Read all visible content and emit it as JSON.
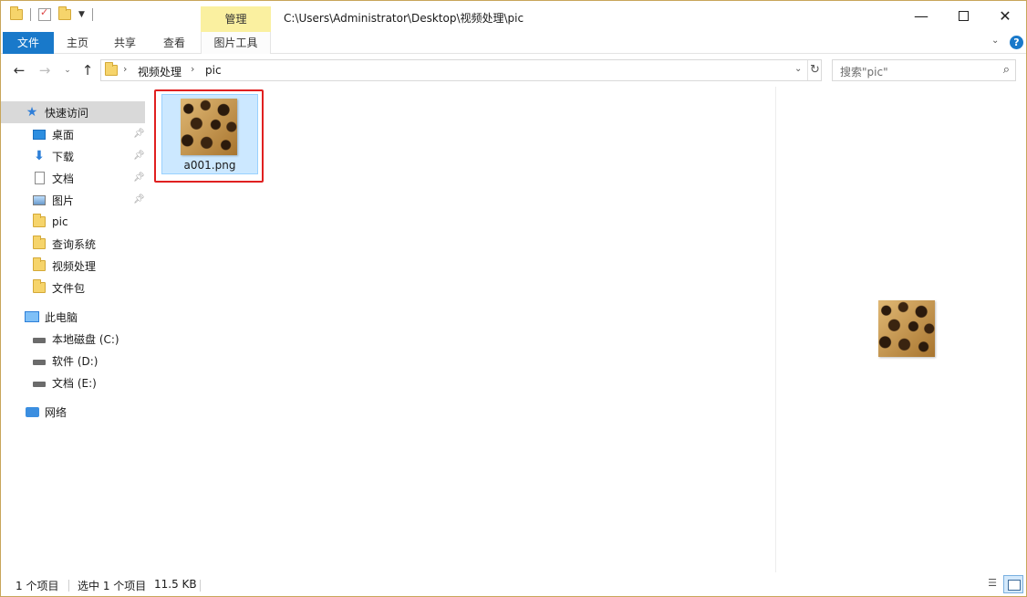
{
  "titlebar": {
    "path": "C:\\Users\\Administrator\\Desktop\\视频处理\\pic",
    "context_tab": "管理",
    "minimize": "—",
    "close": "✕"
  },
  "ribbon": {
    "tabs": [
      "文件",
      "主页",
      "共享",
      "查看",
      "图片工具"
    ],
    "help": "?",
    "collapse": "⌄"
  },
  "address": {
    "crumbs": [
      "视频处理",
      "pic"
    ],
    "separator": "›",
    "search_placeholder": "搜索\"pic\"",
    "search_icon": "⌕"
  },
  "nav": {
    "quick_access": "快速访问",
    "pinned": [
      {
        "label": "桌面",
        "icon": "desktop-icon"
      },
      {
        "label": "下载",
        "icon": "download-icon"
      },
      {
        "label": "文档",
        "icon": "document-icon"
      },
      {
        "label": "图片",
        "icon": "picture-icon"
      }
    ],
    "folders": [
      "pic",
      "查询系统",
      "视频处理",
      "文件包"
    ],
    "this_pc": "此电脑",
    "drives": [
      "本地磁盘 (C:)",
      "软件 (D:)",
      "文档 (E:)"
    ],
    "network": "网络"
  },
  "content": {
    "files": [
      {
        "name": "a001.png",
        "selected": true
      }
    ]
  },
  "status": {
    "item_count": "1 个项目",
    "selected": "选中 1 个项目",
    "size": "11.5 KB"
  },
  "colors": {
    "accent": "#1979ca",
    "context_tab": "#faf0a0",
    "selection": "#cce8ff",
    "highlight": "#e02020"
  }
}
